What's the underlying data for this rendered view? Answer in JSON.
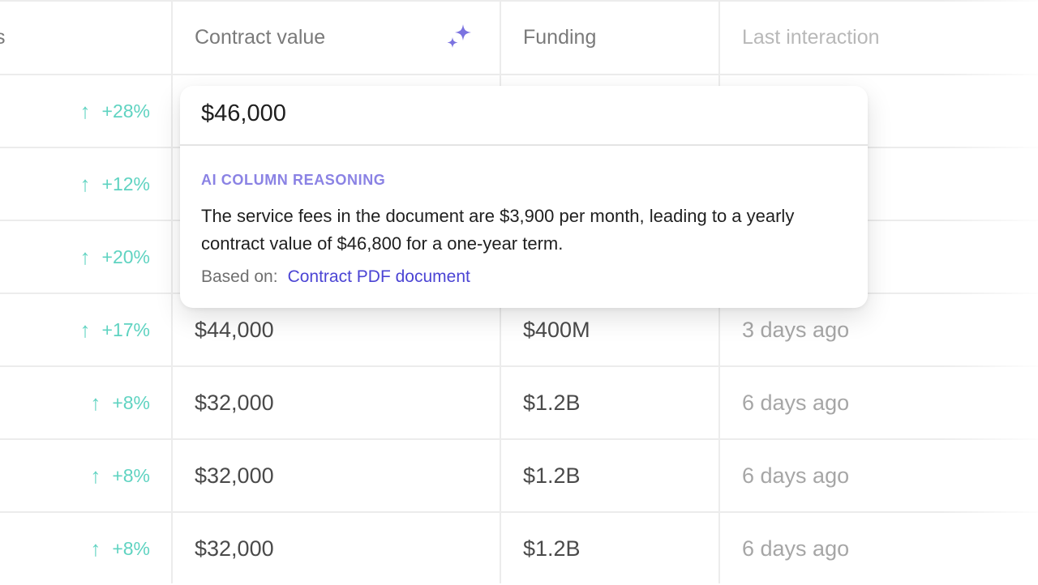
{
  "header": {
    "cut_label": "s",
    "contract_value": "Contract value",
    "funding": "Funding",
    "last_interaction": "Last interaction"
  },
  "icons": {
    "sparkle": "sparkle-icon",
    "arrow": "arrow-up-icon"
  },
  "colors": {
    "positive": "#5fd3c1",
    "ai_accent": "#8a82e4",
    "link": "#4b44d4"
  },
  "rows": [
    {
      "change": "+28%",
      "value": "",
      "funding": "",
      "last": ""
    },
    {
      "change": "+12%",
      "value": "",
      "funding": "",
      "last": ""
    },
    {
      "change": "+20%",
      "value": "",
      "funding": "",
      "last": ""
    },
    {
      "change": "+17%",
      "value": "$44,000",
      "funding": "$400M",
      "last": "3 days ago"
    },
    {
      "change": "+8%",
      "value": "$32,000",
      "funding": "$1.2B",
      "last": "6 days ago"
    },
    {
      "change": "+8%",
      "value": "$32,000",
      "funding": "$1.2B",
      "last": "6 days ago"
    },
    {
      "change": "+8%",
      "value": "$32,000",
      "funding": "$1.2B",
      "last": "6 days ago"
    }
  ],
  "popover": {
    "value": "$46,000",
    "heading": "AI COLUMN REASONING",
    "body": "The service fees in the document are $3,900 per month, leading to a yearly contract value of $46,800 for a one-year term.",
    "source_label": "Based on:",
    "source_link": "Contract PDF document"
  }
}
